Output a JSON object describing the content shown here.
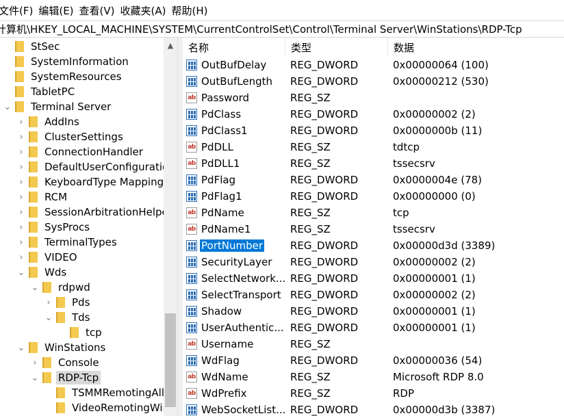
{
  "menu": [
    "文件(F)",
    "编辑(E)",
    "查看(V)",
    "收藏夹(A)",
    "帮助(H)"
  ],
  "address": "计算机\\HKEY_LOCAL_MACHINE\\SYSTEM\\CurrentControlSet\\Control\\Terminal Server\\WinStations\\RDP-Tcp",
  "tree": [
    {
      "label": "StSec",
      "level": 0,
      "expander": "none"
    },
    {
      "label": "SystemInformation",
      "level": 0,
      "expander": "none"
    },
    {
      "label": "SystemResources",
      "level": 0,
      "expander": "none"
    },
    {
      "label": "TabletPC",
      "level": 0,
      "expander": "none"
    },
    {
      "label": "Terminal Server",
      "level": 0,
      "expander": "expanded"
    },
    {
      "label": "AddIns",
      "level": 1,
      "expander": "collapsed"
    },
    {
      "label": "ClusterSettings",
      "level": 1,
      "expander": "collapsed"
    },
    {
      "label": "ConnectionHandler",
      "level": 1,
      "expander": "collapsed"
    },
    {
      "label": "DefaultUserConfiguration",
      "level": 1,
      "expander": "collapsed"
    },
    {
      "label": "KeyboardType Mapping",
      "level": 1,
      "expander": "collapsed"
    },
    {
      "label": "RCM",
      "level": 1,
      "expander": "collapsed"
    },
    {
      "label": "SessionArbitrationHelper",
      "level": 1,
      "expander": "collapsed"
    },
    {
      "label": "SysProcs",
      "level": 1,
      "expander": "collapsed"
    },
    {
      "label": "TerminalTypes",
      "level": 1,
      "expander": "collapsed"
    },
    {
      "label": "VIDEO",
      "level": 1,
      "expander": "collapsed"
    },
    {
      "label": "Wds",
      "level": 1,
      "expander": "expanded"
    },
    {
      "label": "rdpwd",
      "level": 2,
      "expander": "expanded"
    },
    {
      "label": "Pds",
      "level": 3,
      "expander": "collapsed"
    },
    {
      "label": "Tds",
      "level": 3,
      "expander": "expanded"
    },
    {
      "label": "tcp",
      "level": 4,
      "expander": "none"
    },
    {
      "label": "WinStations",
      "level": 1,
      "expander": "expanded"
    },
    {
      "label": "Console",
      "level": 2,
      "expander": "collapsed"
    },
    {
      "label": "RDP-Tcp",
      "level": 2,
      "expander": "expanded",
      "selected": true
    },
    {
      "label": "TSMMRemotingAllc",
      "level": 3,
      "expander": "none"
    },
    {
      "label": "VideoRemotingWin",
      "level": 3,
      "expander": "none"
    }
  ],
  "columns": {
    "name": "名称",
    "type": "类型",
    "data": "数据"
  },
  "values": [
    {
      "name": "OutBufDelay",
      "type": "REG_DWORD",
      "data": "0x00000064 (100)"
    },
    {
      "name": "OutBufLength",
      "type": "REG_DWORD",
      "data": "0x00000212 (530)"
    },
    {
      "name": "Password",
      "type": "REG_SZ",
      "data": ""
    },
    {
      "name": "PdClass",
      "type": "REG_DWORD",
      "data": "0x00000002 (2)"
    },
    {
      "name": "PdClass1",
      "type": "REG_DWORD",
      "data": "0x0000000b (11)"
    },
    {
      "name": "PdDLL",
      "type": "REG_SZ",
      "data": "tdtcp"
    },
    {
      "name": "PdDLL1",
      "type": "REG_SZ",
      "data": "tssecsrv"
    },
    {
      "name": "PdFlag",
      "type": "REG_DWORD",
      "data": "0x0000004e (78)"
    },
    {
      "name": "PdFlag1",
      "type": "REG_DWORD",
      "data": "0x00000000 (0)"
    },
    {
      "name": "PdName",
      "type": "REG_SZ",
      "data": "tcp"
    },
    {
      "name": "PdName1",
      "type": "REG_SZ",
      "data": "tssecsrv"
    },
    {
      "name": "PortNumber",
      "type": "REG_DWORD",
      "data": "0x00000d3d (3389)",
      "selected": true
    },
    {
      "name": "SecurityLayer",
      "type": "REG_DWORD",
      "data": "0x00000002 (2)"
    },
    {
      "name": "SelectNetwork...",
      "type": "REG_DWORD",
      "data": "0x00000001 (1)"
    },
    {
      "name": "SelectTransport",
      "type": "REG_DWORD",
      "data": "0x00000002 (2)"
    },
    {
      "name": "Shadow",
      "type": "REG_DWORD",
      "data": "0x00000001 (1)"
    },
    {
      "name": "UserAuthentic...",
      "type": "REG_DWORD",
      "data": "0x00000001 (1)"
    },
    {
      "name": "Username",
      "type": "REG_SZ",
      "data": ""
    },
    {
      "name": "WdFlag",
      "type": "REG_DWORD",
      "data": "0x00000036 (54)"
    },
    {
      "name": "WdName",
      "type": "REG_SZ",
      "data": "Microsoft RDP 8.0"
    },
    {
      "name": "WdPrefix",
      "type": "REG_SZ",
      "data": "RDP"
    },
    {
      "name": "WebSocketList...",
      "type": "REG_DWORD",
      "data": "0x00000d3b (3387)"
    }
  ],
  "icons": {
    "string_value": "reg-sz-icon",
    "dword_value": "reg-dword-icon",
    "folder": "folder-icon"
  },
  "colors": {
    "selection": "#0078d7",
    "folder": "#f3c94f",
    "tree_selection": "#d9d9d9"
  }
}
